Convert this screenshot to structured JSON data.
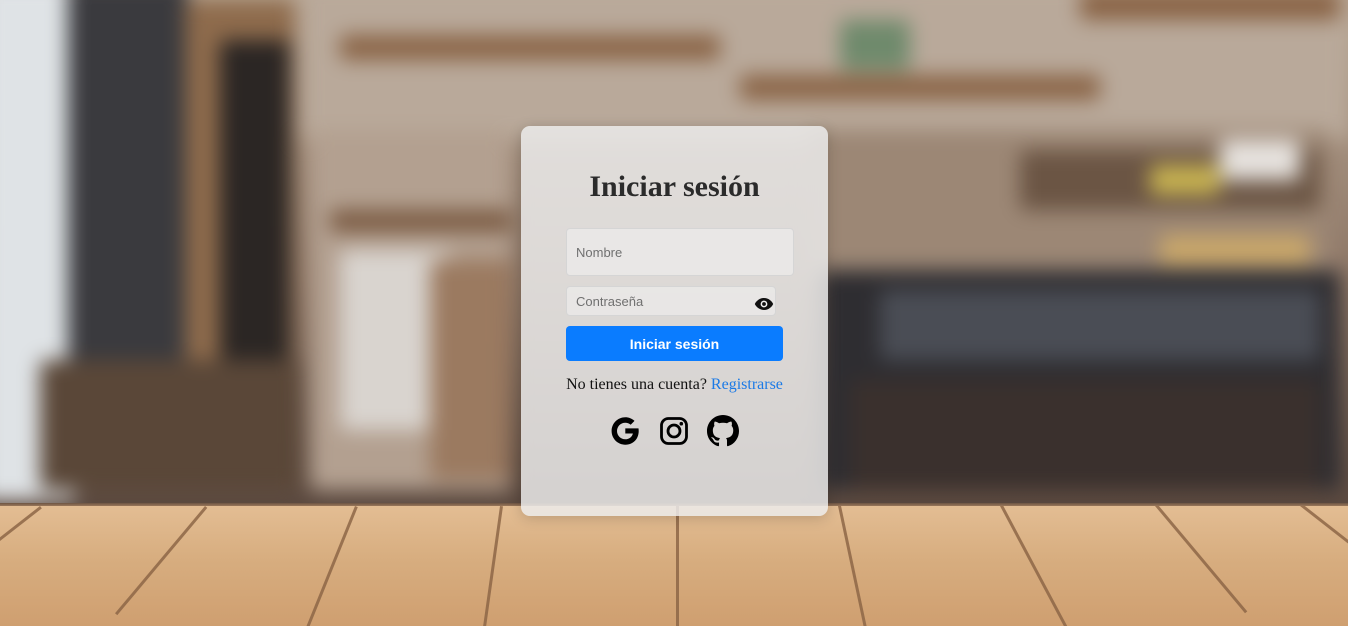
{
  "login": {
    "title": "Iniciar sesión",
    "name_placeholder": "Nombre",
    "password_placeholder": "Contraseña",
    "submit_label": "Iniciar sesión",
    "register_prompt": "No tienes una cuenta?",
    "register_link": "Registrarse"
  },
  "social": [
    {
      "icon": "google-icon"
    },
    {
      "icon": "instagram-icon"
    },
    {
      "icon": "github-icon"
    }
  ],
  "colors": {
    "accent": "#0a7cff",
    "link": "#1b7ae6",
    "title": "#2b2b2b"
  }
}
